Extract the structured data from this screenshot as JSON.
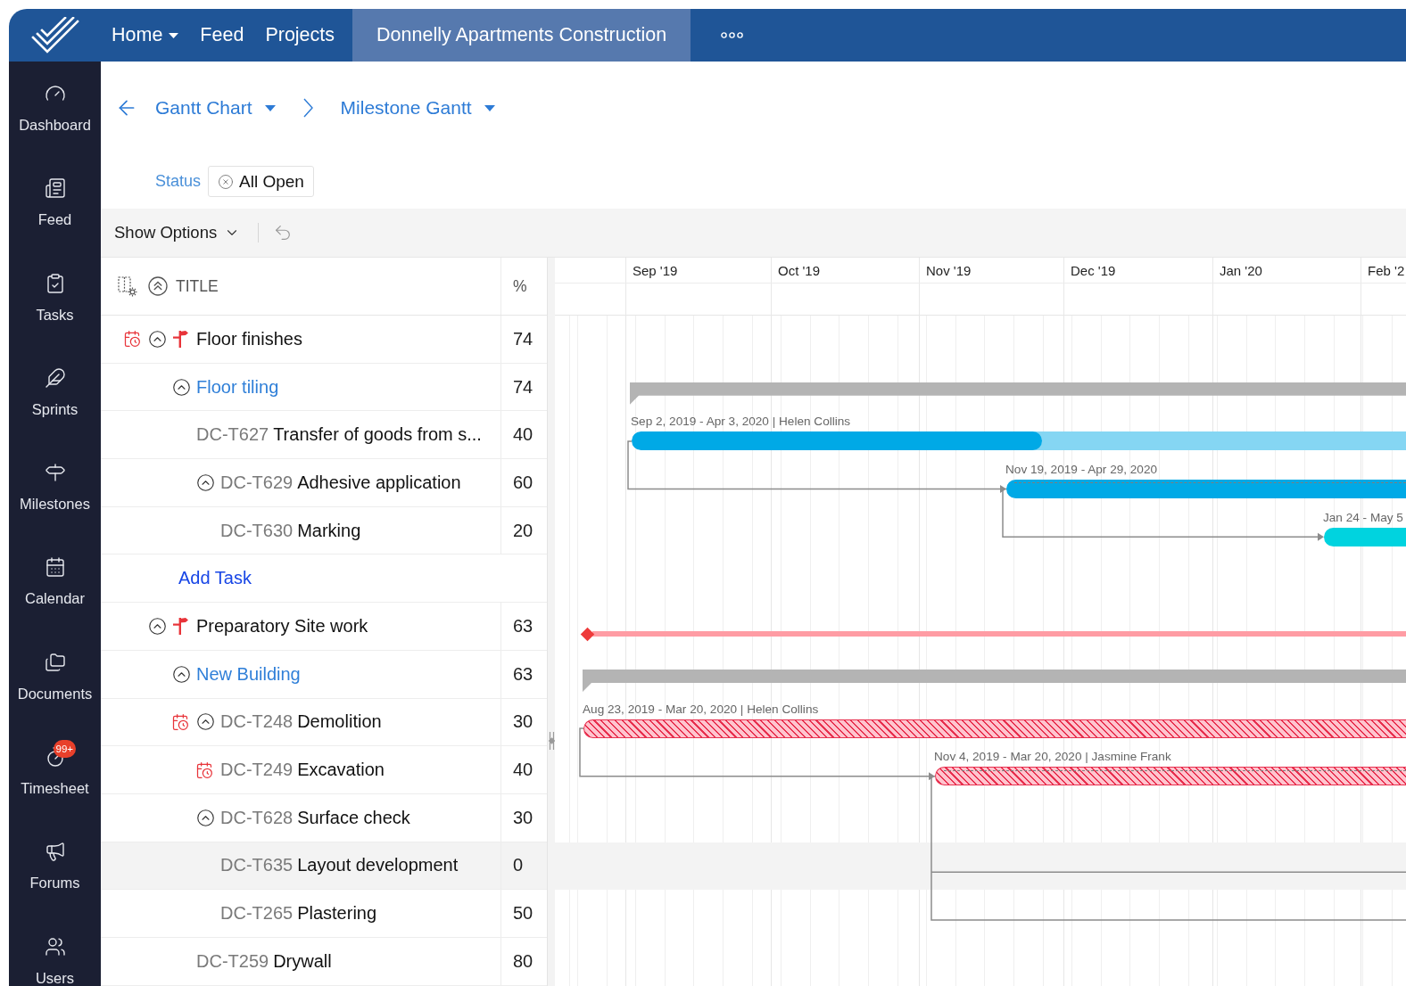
{
  "top_nav": {
    "items": [
      {
        "label": "Home",
        "caret": true,
        "selected": false
      },
      {
        "label": "Feed",
        "caret": false,
        "selected": false
      },
      {
        "label": "Projects",
        "caret": false,
        "selected": false
      },
      {
        "label": "Donnelly Apartments Construction",
        "caret": false,
        "selected": true
      }
    ]
  },
  "sidebar": {
    "items": [
      {
        "label": "Dashboard"
      },
      {
        "label": "Feed"
      },
      {
        "label": "Tasks"
      },
      {
        "label": "Sprints"
      },
      {
        "label": "Milestones"
      },
      {
        "label": "Calendar"
      },
      {
        "label": "Documents"
      },
      {
        "label": "Timesheet",
        "badge": "99+"
      },
      {
        "label": "Forums"
      },
      {
        "label": "Users"
      }
    ]
  },
  "breadcrumb": {
    "items": [
      {
        "label": "Gantt Chart"
      },
      {
        "label": "Milestone Gantt"
      }
    ]
  },
  "filter": {
    "label": "Status",
    "value": "All Open"
  },
  "toolbar": {
    "options_button": "Show Options"
  },
  "table": {
    "columns": [
      "TITLE",
      "%"
    ],
    "rows": [
      {
        "kind": "milestone",
        "title": "Floor finishes",
        "percent": "74",
        "overdue": true,
        "expanded": true,
        "selected": false,
        "children": [
          {
            "kind": "tasklist",
            "title": "Floor tiling",
            "percent": "74",
            "overdue": false,
            "expanded": true,
            "selected": false,
            "add_task": "Add Task",
            "children": [
              {
                "kind": "task",
                "key": "DC-T627",
                "title": "Transfer of goods from s...",
                "percent": "40",
                "overdue": false,
                "selected": false
              },
              {
                "kind": "task",
                "key": "DC-T629",
                "title": "Adhesive application",
                "percent": "60",
                "overdue": false,
                "expanded": true,
                "selected": false,
                "children": [
                  {
                    "kind": "task",
                    "key": "DC-T630",
                    "title": "Marking",
                    "percent": "20",
                    "overdue": false,
                    "selected": false
                  }
                ]
              }
            ]
          }
        ]
      },
      {
        "kind": "milestone",
        "title": "Preparatory Site work",
        "percent": "63",
        "overdue": false,
        "expanded": true,
        "selected": false,
        "children": [
          {
            "kind": "tasklist",
            "title": "New Building",
            "percent": "63",
            "overdue": false,
            "expanded": true,
            "selected": false,
            "children": [
              {
                "kind": "task",
                "key": "DC-T248",
                "title": "Demolition",
                "percent": "30",
                "overdue": true,
                "expanded": true,
                "selected": false,
                "children": [
                  {
                    "kind": "task",
                    "key": "DC-T249",
                    "title": "Excavation",
                    "percent": "40",
                    "overdue": true,
                    "selected": false
                  }
                ]
              },
              {
                "kind": "task",
                "key": "DC-T628",
                "title": "Surface check",
                "percent": "30",
                "overdue": false,
                "expanded": true,
                "selected": false,
                "children": [
                  {
                    "kind": "task",
                    "key": "DC-T635",
                    "title": "Layout development",
                    "percent": "0",
                    "overdue": false,
                    "selected": true
                  },
                  {
                    "kind": "task",
                    "key": "DC-T265",
                    "title": "Plastering",
                    "percent": "50",
                    "overdue": false,
                    "selected": false
                  }
                ]
              },
              {
                "kind": "task",
                "key": "DC-T259",
                "title": "Drywall",
                "percent": "80",
                "overdue": false,
                "selected": false
              }
            ]
          }
        ]
      }
    ]
  },
  "gantt": {
    "months": [
      "Sep '19",
      "Oct '19",
      "Nov '19",
      "Dec '19",
      "Jan '20",
      "Feb '2"
    ],
    "bars": [
      {
        "kind": "summary"
      },
      {
        "kind": "task",
        "label": "Sep 2, 2019 - Apr 3, 2020 | Helen Collins",
        "color": "#00a9e6",
        "level": 0.53,
        "overdue": false,
        "dashed": false
      },
      {
        "kind": "task",
        "label": "Nov 19, 2019 - Apr 29, 2020",
        "color": "#00a9e6",
        "overdue": false,
        "dashed": true
      },
      {
        "kind": "task",
        "label": "Jan 24 - May 5",
        "color": "#00d3df",
        "overdue": false,
        "dashed": false
      },
      {
        "kind": "milestone"
      },
      {
        "kind": "summary"
      },
      {
        "kind": "task",
        "label": "Aug 23, 2019 - Mar 20, 2020 | Helen Collins",
        "color": "#e8304f",
        "overdue": true,
        "dashed": false
      },
      {
        "kind": "task",
        "label": "Nov 4, 2019 - Mar 20, 2020 | Jasmine Frank",
        "color": "#e8304f",
        "overdue": true,
        "dashed": true
      }
    ]
  }
}
